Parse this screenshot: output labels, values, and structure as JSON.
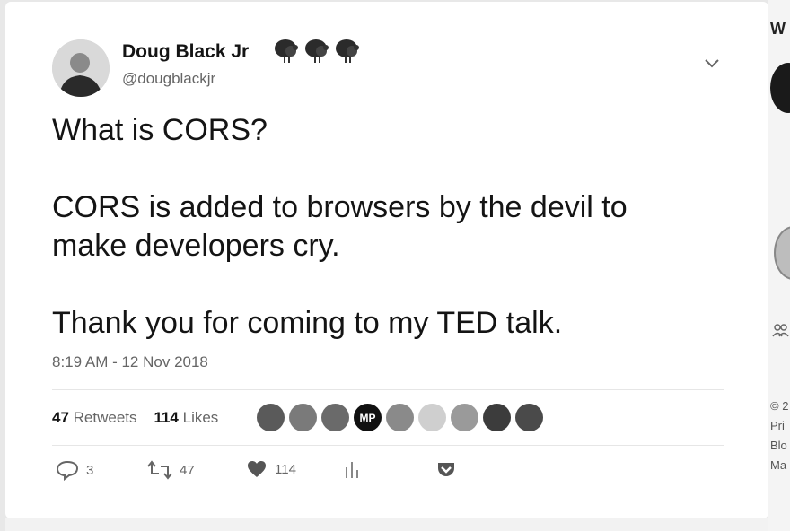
{
  "tweet": {
    "author_name": "Doug Black Jr",
    "handle": "@dougblackjr",
    "name_emoji_icons": [
      "turkey-icon",
      "turkey-icon",
      "turkey-icon"
    ],
    "text_lines": [
      "What is CORS?",
      "",
      "CORS is added to browsers by the devil to",
      "make developers cry.",
      "",
      "Thank you for coming to my TED talk."
    ],
    "timestamp": "8:19 AM - 12 Nov 2018",
    "retweets_count": "47",
    "retweets_label": "Retweets",
    "likes_count": "114",
    "likes_label": "Likes",
    "likers": [
      {
        "icon": "avatar-icon",
        "initials": ""
      },
      {
        "icon": "avatar-icon",
        "initials": ""
      },
      {
        "icon": "avatar-icon",
        "initials": ""
      },
      {
        "icon": "avatar-icon",
        "initials": "MP"
      },
      {
        "icon": "avatar-icon",
        "initials": ""
      },
      {
        "icon": "avatar-icon",
        "initials": ""
      },
      {
        "icon": "avatar-icon",
        "initials": ""
      },
      {
        "icon": "avatar-icon",
        "initials": ""
      },
      {
        "icon": "avatar-icon",
        "initials": ""
      }
    ],
    "actions": {
      "reply": {
        "icon": "reply-icon",
        "count": "3"
      },
      "retweet": {
        "icon": "retweet-icon",
        "count": "47"
      },
      "like": {
        "icon": "heart-icon",
        "count": "114"
      },
      "analytics": {
        "icon": "analytics-icon"
      },
      "pocket": {
        "icon": "pocket-icon"
      }
    }
  },
  "sidebar": {
    "title_fragment": "W",
    "icon": "people-icon",
    "footer_fragments": [
      "© 2",
      "Pri",
      "Blo",
      "Ma"
    ]
  },
  "colors": {
    "background": "#ffffff",
    "text": "#141414",
    "muted": "#666666",
    "divider": "#e6e6e6"
  }
}
